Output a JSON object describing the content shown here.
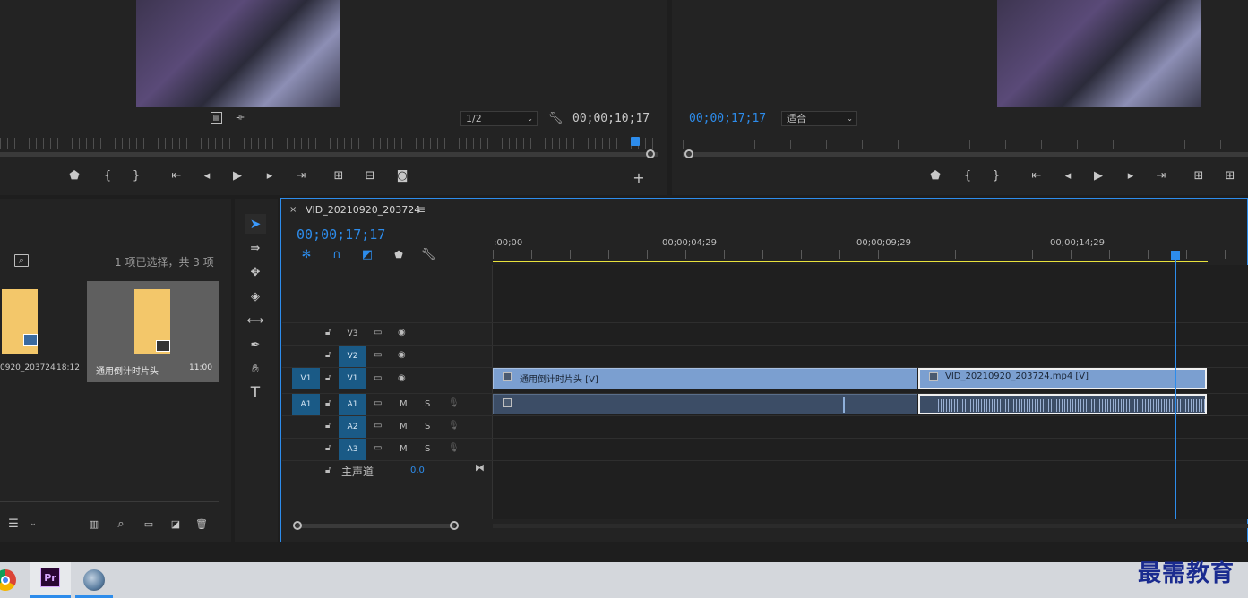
{
  "source_monitor": {
    "zoom_value": "1/2",
    "timecode": "00;00;10;17"
  },
  "program_monitor": {
    "timecode": "00;00;17;17",
    "zoom_value": "适合"
  },
  "project": {
    "selection_info": "1 项已选择，共 3 项",
    "items": [
      {
        "name": "0920_203724",
        "duration": "18:12"
      },
      {
        "name": "通用倒计时片头",
        "duration": "11:00"
      }
    ]
  },
  "timeline": {
    "tab_name": "VID_20210920_203724",
    "timecode": "00;00;17;17",
    "ruler_labels": [
      ":00;00",
      "00;00;04;29",
      "00;00;09;29",
      "00;00;14;29"
    ],
    "playhead_fraction": 0.945,
    "tracks": {
      "V3": "V3",
      "V2": "V2",
      "V1": "V1",
      "V1_src": "V1",
      "A1_src": "A1",
      "A1": "A1",
      "A2": "A2",
      "A3": "A3",
      "M": "M",
      "S": "S"
    },
    "master": {
      "label": "主声道",
      "value": "0.0"
    },
    "clips": {
      "v1_a": "通用倒计时片头 [V]",
      "v1_b": "VID_20210920_203724.mp4 [V]"
    }
  },
  "taskbar": {
    "app_label": "Pr"
  },
  "watermark": "最需教育",
  "colors": {
    "accent": "#2d8ceb",
    "clip_video": "#7b9fd0",
    "clip_audio": "#3c4d66",
    "work_area": "#e8e23c"
  }
}
